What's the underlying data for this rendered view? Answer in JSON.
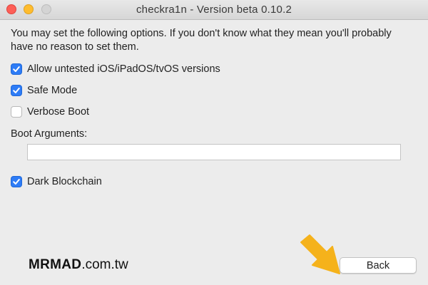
{
  "window": {
    "title": "checkra1n - Version beta 0.10.2"
  },
  "intro_text": "You may set the following options. If you don't know what they mean you'll probably have no reason to set them.",
  "options": [
    {
      "label": "Allow untested iOS/iPadOS/tvOS versions",
      "checked": true
    },
    {
      "label": "Safe Mode",
      "checked": true
    },
    {
      "label": "Verbose Boot",
      "checked": false
    }
  ],
  "boot_arguments": {
    "label": "Boot Arguments:",
    "value": ""
  },
  "dark_blockchain": {
    "label": "Dark Blockchain",
    "checked": true
  },
  "watermark": {
    "bold": "MRMAD",
    "light": ".com.tw"
  },
  "back_button": {
    "label": "Back"
  },
  "colors": {
    "accent": "#2e7cf6",
    "arrow": "#f5b21b",
    "close": "#fd5f57",
    "minimize": "#febc2e"
  },
  "icons": [
    "check-icon",
    "arrow-pointer-icon"
  ]
}
